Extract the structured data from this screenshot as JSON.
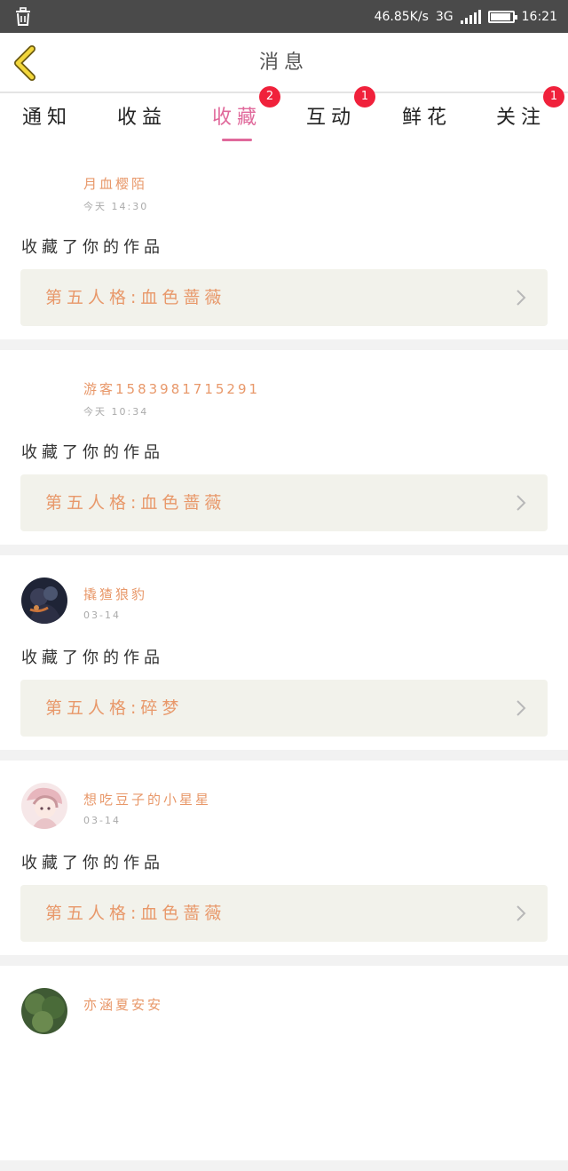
{
  "status_bar": {
    "network_speed": "46.85K/s",
    "network_type": "3G",
    "time": "16:21",
    "battery_level": 0.95
  },
  "header": {
    "title": "消息"
  },
  "tabs": [
    {
      "label": "通知",
      "badge": ""
    },
    {
      "label": "收益",
      "badge": ""
    },
    {
      "label": "收藏",
      "badge": "2",
      "active": true
    },
    {
      "label": "互动",
      "badge": "1"
    },
    {
      "label": "鲜花",
      "badge": ""
    },
    {
      "label": "关注",
      "badge": "1"
    }
  ],
  "messages": [
    {
      "username": "月血樱陌",
      "time": "今天 14:30",
      "action": "收藏了你的作品",
      "work": "第五人格:血色蔷薇",
      "avatar": "none"
    },
    {
      "username": "游客1583981715291",
      "time": "今天 10:34",
      "action": "收藏了你的作品",
      "work": "第五人格:血色蔷薇",
      "avatar": "none"
    },
    {
      "username": "撬猹狼豹",
      "time": "03-14",
      "action": "收藏了你的作品",
      "work": "第五人格:碎梦",
      "avatar": "dark"
    },
    {
      "username": "想吃豆子的小星星",
      "time": "03-14",
      "action": "收藏了你的作品",
      "work": "第五人格:血色蔷薇",
      "avatar": "pink"
    },
    {
      "username": "亦涵夏安安",
      "time": "",
      "action": "",
      "work": "",
      "avatar": "green"
    }
  ],
  "colors": {
    "accent": "#e0699b",
    "username": "#e8986a",
    "badge": "#f0213b"
  }
}
